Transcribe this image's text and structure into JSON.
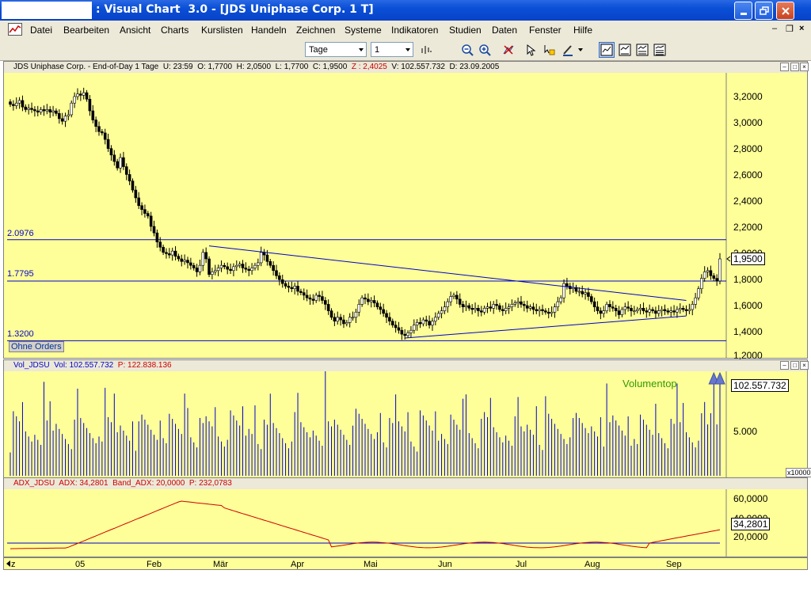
{
  "window": {
    "title": ": Visual Chart  3.0 - [JDS Uniphase Corp. 1 T]"
  },
  "menu": {
    "items": [
      "Datei",
      "Bearbeiten",
      "Ansicht",
      "Charts",
      "Kurslisten",
      "Handeln",
      "Zeichnen",
      "Systeme",
      "Indikatoren",
      "Studien",
      "Daten",
      "Fenster",
      "Hilfe"
    ]
  },
  "toolbar": {
    "period_value": "Tage",
    "interval_value": "1"
  },
  "price_panel": {
    "header": {
      "name": "JDS Uniphase Corp. - End-of-Day 1 Tage",
      "time": "U: 23:59",
      "open": "O: 1,7700",
      "high": "H: 2,0500",
      "low": "L: 1,7700",
      "close": "C: 1,9500",
      "z": "Z : 2,4025",
      "volume": "V: 102.557.732",
      "date": "D: 23.09.2005"
    },
    "y_ticks": [
      "3,2000",
      "3,0000",
      "2,8000",
      "2,6000",
      "2,4000",
      "2,2000",
      "2,0000",
      "1,8000",
      "1,6000",
      "1,4000",
      "1,2000"
    ],
    "hline_labels": [
      "2.0976",
      "1.7795",
      "1.3200"
    ],
    "last_price": "1,9500",
    "orders_button": "Ohne Orders"
  },
  "volume_panel": {
    "header_name": "Vol_JDSU",
    "header_vol": "Vol: 102.557.732",
    "header_p": "P: 122.838.136",
    "y_tick": "5.000",
    "last_value": "102.557.732",
    "annotation": "Volumentop",
    "multiplier": "x10000"
  },
  "adx_panel": {
    "header_name": "ADX_JDSU",
    "header_adx": "ADX: 34,2801",
    "header_band": "Band_ADX: 20,0000",
    "header_p": "P: 232,0783",
    "y_ticks": [
      "60,0000",
      "40,0000",
      "20,0000"
    ],
    "last_value": "34,2801"
  },
  "x_axis": {
    "labels": [
      "z",
      "05",
      "Feb",
      "Mär",
      "Apr",
      "Mai",
      "Jun",
      "Jul",
      "Aug",
      "Sep"
    ]
  },
  "colors": {
    "panel_bg": "#ffff99",
    "line_blue": "#0000cc",
    "adx_red": "#cc0000",
    "annotation_green": "#339900",
    "header_red": "#cc0000"
  },
  "chart_data": {
    "type": "candlestick",
    "title": "JDS Uniphase Corp. - End-of-Day 1 Tage",
    "ylim": [
      1.2,
      3.3
    ],
    "close_series_approx": [
      3.14,
      3.13,
      3.15,
      3.17,
      3.12,
      3.1,
      3.11,
      3.1,
      3.09,
      3.08,
      3.1,
      3.09,
      3.1,
      3.08,
      3.09,
      3.07,
      3.03,
      3.01,
      3.05,
      3.06,
      3.15,
      3.2,
      3.22,
      3.21,
      3.23,
      3.18,
      3.09,
      3.02,
      2.97,
      2.93,
      2.92,
      2.87,
      2.8,
      2.75,
      2.7,
      2.65,
      2.73,
      2.66,
      2.6,
      2.55,
      2.48,
      2.42,
      2.36,
      2.33,
      2.3,
      2.28,
      2.2,
      2.15,
      2.08,
      2.04,
      2.0,
      1.99,
      1.98,
      2.01,
      1.97,
      1.95,
      1.93,
      1.94,
      1.92,
      1.9,
      1.88,
      1.85,
      1.9,
      2.0,
      1.95,
      1.83,
      1.85,
      1.86,
      1.88,
      1.9,
      1.89,
      1.87,
      1.86,
      1.89,
      1.9,
      1.91,
      1.88,
      1.87,
      1.86,
      1.88,
      1.9,
      1.92,
      2.0,
      1.98,
      1.93,
      1.9,
      1.86,
      1.82,
      1.79,
      1.76,
      1.74,
      1.73,
      1.72,
      1.74,
      1.7,
      1.69,
      1.67,
      1.65,
      1.64,
      1.63,
      1.67,
      1.66,
      1.63,
      1.6,
      1.55,
      1.5,
      1.47,
      1.5,
      1.48,
      1.45,
      1.46,
      1.5,
      1.5,
      1.54,
      1.6,
      1.65,
      1.64,
      1.62,
      1.63,
      1.61,
      1.58,
      1.56,
      1.53,
      1.5,
      1.47,
      1.44,
      1.42,
      1.4,
      1.37,
      1.36,
      1.38,
      1.4,
      1.44,
      1.46,
      1.45,
      1.48,
      1.47,
      1.44,
      1.47,
      1.5,
      1.53,
      1.55,
      1.58,
      1.62,
      1.66,
      1.67,
      1.64,
      1.6,
      1.58,
      1.59,
      1.57,
      1.56,
      1.57,
      1.55,
      1.54,
      1.57,
      1.58,
      1.57,
      1.6,
      1.59,
      1.56,
      1.55,
      1.57,
      1.58,
      1.6,
      1.61,
      1.62,
      1.6,
      1.59,
      1.57,
      1.58,
      1.56,
      1.55,
      1.56,
      1.55,
      1.54,
      1.53,
      1.54,
      1.58,
      1.62,
      1.65,
      1.76,
      1.74,
      1.72,
      1.73,
      1.7,
      1.7,
      1.68,
      1.69,
      1.66,
      1.62,
      1.58,
      1.55,
      1.53,
      1.55,
      1.6,
      1.58,
      1.57,
      1.55,
      1.52,
      1.56,
      1.58,
      1.57,
      1.55,
      1.55,
      1.56,
      1.57,
      1.55,
      1.54,
      1.56,
      1.55,
      1.53,
      1.55,
      1.56,
      1.55,
      1.54,
      1.55,
      1.54,
      1.56,
      1.57,
      1.56,
      1.55,
      1.56,
      1.6,
      1.65,
      1.72,
      1.8,
      1.85,
      1.86,
      1.82,
      1.8,
      1.78,
      1.95
    ],
    "horizontal_levels": [
      2.0976,
      1.7795,
      1.32
    ],
    "volume_ylim": [
      0,
      10000
    ],
    "adx_ylim": [
      0,
      70
    ],
    "adx_band": 20.0
  }
}
